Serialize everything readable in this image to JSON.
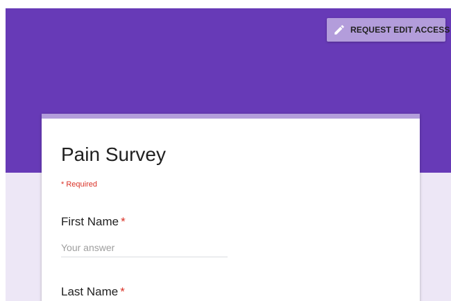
{
  "header": {
    "request_edit_label": "REQUEST EDIT ACCESS",
    "edit_icon": "pencil-icon",
    "accent_color": "#673ab7",
    "button_color": "#b39ddb"
  },
  "form": {
    "title": "Pain Survey",
    "required_note": "* Required",
    "questions": [
      {
        "label": "First Name",
        "required_mark": "*",
        "placeholder": "Your answer"
      },
      {
        "label": "Last Name",
        "required_mark": "*"
      }
    ],
    "required_color": "#d93025"
  }
}
